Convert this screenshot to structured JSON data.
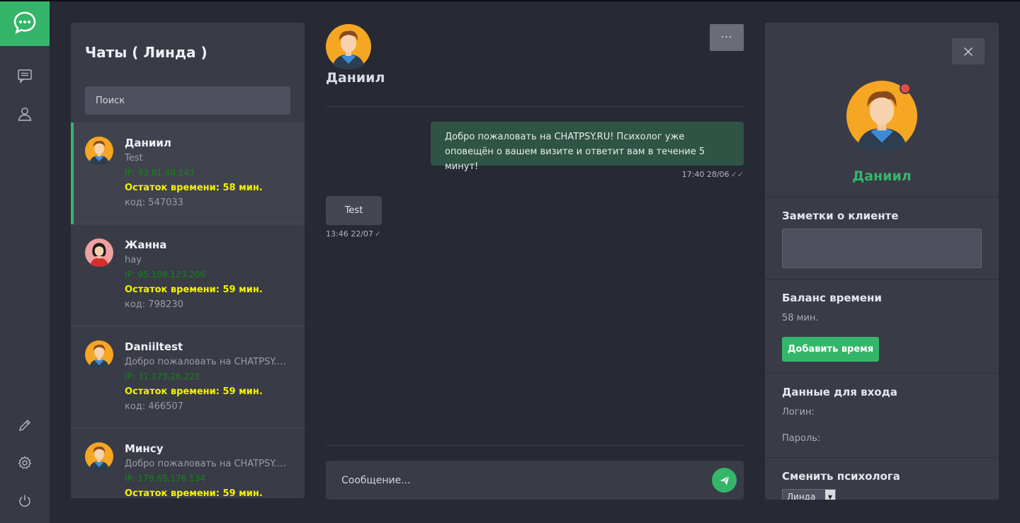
{
  "colors": {
    "accent": "#35b56a",
    "remaining": "#f3f300",
    "ip": "#0f8a10",
    "alert": "#e54b4b"
  },
  "rail": {
    "logo_icon": "chat-bubble-icon",
    "top_icons": [
      "messages-icon",
      "user-icon"
    ],
    "bottom_icons": [
      "pencil-icon",
      "gear-icon",
      "power-icon"
    ]
  },
  "chats": {
    "title": "Чаты ( Линда )",
    "search_placeholder": "Поиск",
    "items": [
      {
        "name": "Даниил",
        "preview": "Test",
        "ip": "IP: 93.81.48.143",
        "remaining": "Остаток времени: 58 мин.",
        "code": "код: 547033",
        "avatar": "male-avatar"
      },
      {
        "name": "Жанна",
        "preview": "hay",
        "ip": "IP: 95.108.123.206",
        "remaining": "Остаток времени: 59 мин.",
        "code": "код: 798230",
        "avatar": "female-avatar"
      },
      {
        "name": "Daniiltest",
        "preview": "Добро пожаловать на CHATPSY.RU!",
        "ip": "IP: 31.173.26.221",
        "remaining": "Остаток времени: 59 мин.",
        "code": "код: 466507",
        "avatar": "male-avatar"
      },
      {
        "name": "Минсу",
        "preview": "Добро пожаловать на CHATPSY.RU!",
        "ip": "IP: 178.65.176.134",
        "remaining": "Остаток времени: 59 мин.",
        "code": "",
        "avatar": "male-avatar"
      }
    ]
  },
  "conversation": {
    "name": "Даниил",
    "more_label": "···",
    "messages": [
      {
        "direction": "out",
        "text": "Добро пожаловать на CHATPSY.RU! Психолог уже оповещён о вашем визите и ответит вам в течение 5 минут!",
        "time": "17:40 28/06"
      },
      {
        "direction": "in",
        "text": "Test",
        "time": "13:46 22/07"
      }
    ],
    "input_placeholder": "Сообщение..."
  },
  "profile": {
    "name": "Даниил",
    "notes_title": "Заметки о клиенте",
    "balance_title": "Баланс времени",
    "balance_value": "58 мин.",
    "add_time_label": "Добавить время",
    "login_title": "Данные для входа",
    "login_label": "Логин:",
    "password_label": "Пароль:",
    "change_psych_title": "Сменить психолога",
    "psychologist_selected": "Линда"
  }
}
